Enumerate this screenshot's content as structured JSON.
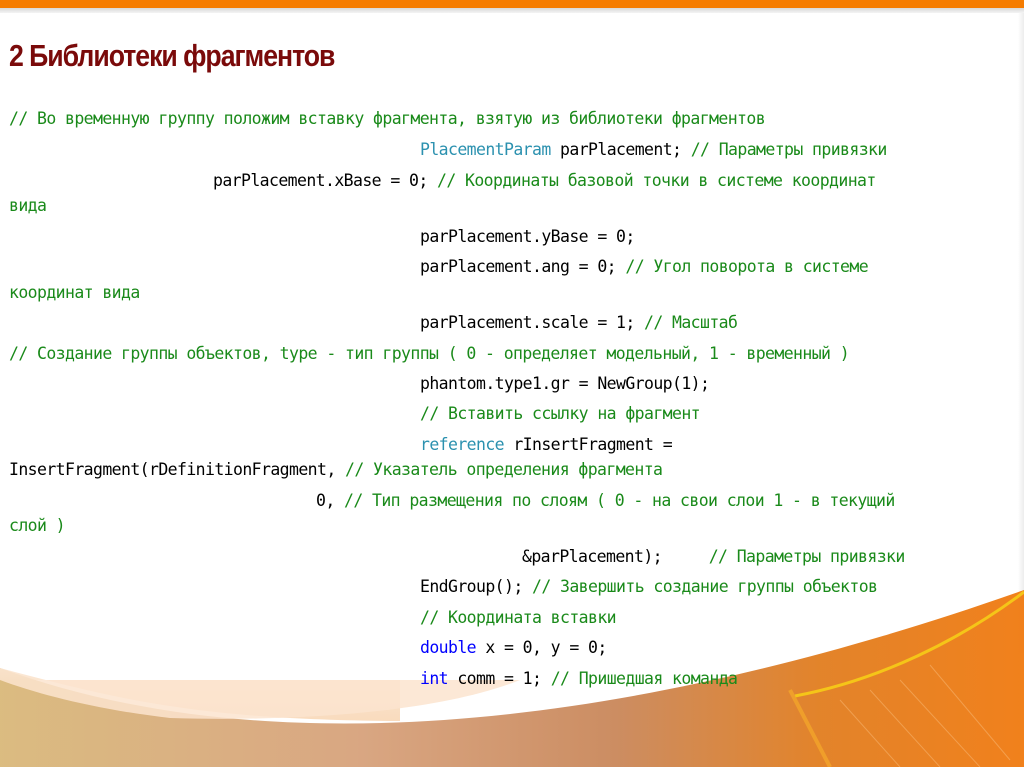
{
  "slide": {
    "title": "2 Библиотеки фрагментов",
    "colors": {
      "title": "#7a0a0a",
      "top_bar": "#f57c00",
      "comment": "#1a8a1a",
      "type": "#2b91af",
      "keyword": "#0000ff",
      "code": "#000000"
    }
  },
  "code_lines": [
    {
      "segments": [
        {
          "kind": "comment",
          "text": "// Во временную группу положим вставку фрагмента, взятую из библиотеки фрагментов"
        }
      ]
    },
    {
      "segments": [
        {
          "kind": "type",
          "text": "PlacementParam"
        },
        {
          "kind": "plain",
          "text": " parPlacement; "
        },
        {
          "kind": "comment",
          "text": "// Параметры привязки"
        }
      ]
    },
    {
      "segments": [
        {
          "kind": "plain",
          "text": "parPlacement.xBase = 0; "
        },
        {
          "kind": "comment",
          "text": "// Координаты базовой точки в системе координат"
        }
      ]
    },
    {
      "segments": [
        {
          "kind": "comment",
          "text": "вида"
        }
      ]
    },
    {
      "segments": [
        {
          "kind": "plain",
          "text": "parPlacement.yBase = 0;"
        }
      ]
    },
    {
      "segments": [
        {
          "kind": "plain",
          "text": "parPlacement.ang = 0; "
        },
        {
          "kind": "comment",
          "text": "// Угол поворота в системе"
        }
      ]
    },
    {
      "segments": [
        {
          "kind": "comment",
          "text": "координат вида"
        }
      ]
    },
    {
      "segments": [
        {
          "kind": "plain",
          "text": "parPlacement.scale = 1; "
        },
        {
          "kind": "comment",
          "text": "// Масштаб"
        }
      ]
    },
    {
      "segments": [
        {
          "kind": "comment",
          "text": "// Создание группы объектов, type - тип группы ( 0 - определяет модельный, 1 - временный )"
        }
      ]
    },
    {
      "segments": [
        {
          "kind": "plain",
          "text": "phantom.type1.gr = NewGroup(1);"
        }
      ]
    },
    {
      "segments": [
        {
          "kind": "comment",
          "text": "// Вставить ссылку на фрагмент"
        }
      ]
    },
    {
      "segments": [
        {
          "kind": "type",
          "text": "reference"
        },
        {
          "kind": "plain",
          "text": " rInsertFragment ="
        }
      ]
    },
    {
      "segments": [
        {
          "kind": "plain",
          "text": "InsertFragment(rDefinitionFragment, "
        },
        {
          "kind": "comment",
          "text": "// Указатель определения фрагмента"
        }
      ]
    },
    {
      "segments": [
        {
          "kind": "plain",
          "text": "0, "
        },
        {
          "kind": "comment",
          "text": "// Тип размещения по слоям ( 0 - на свои слои 1 - в текущий"
        }
      ]
    },
    {
      "segments": [
        {
          "kind": "comment",
          "text": "слой )"
        }
      ]
    },
    {
      "segments": [
        {
          "kind": "plain",
          "text": "&parPlacement);     "
        },
        {
          "kind": "comment",
          "text": "// Параметры привязки"
        }
      ]
    },
    {
      "segments": [
        {
          "kind": "plain",
          "text": "EndGroup(); "
        },
        {
          "kind": "comment",
          "text": "// Завершить создание группы объектов"
        }
      ]
    },
    {
      "segments": [
        {
          "kind": "comment",
          "text": "// Координата вставки"
        }
      ]
    },
    {
      "segments": [
        {
          "kind": "keyword",
          "text": "double"
        },
        {
          "kind": "plain",
          "text": " x = 0, y = 0;"
        }
      ]
    },
    {
      "segments": [
        {
          "kind": "keyword",
          "text": "int"
        },
        {
          "kind": "plain",
          "text": " comm = 1; "
        },
        {
          "kind": "comment",
          "text": "// Пришедшая команда"
        }
      ]
    }
  ]
}
